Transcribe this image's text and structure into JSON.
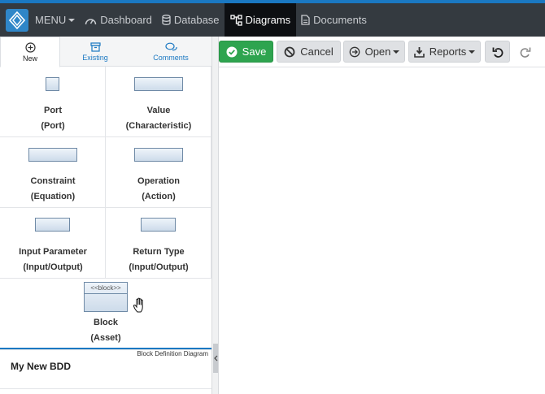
{
  "navbar": {
    "menu_label": "MENU",
    "items": [
      {
        "label": "Dashboard",
        "icon": "gauge-icon"
      },
      {
        "label": "Database",
        "icon": "database-icon"
      },
      {
        "label": "Diagrams",
        "icon": "diagram-icon",
        "active": true
      },
      {
        "label": "Documents",
        "icon": "document-icon"
      }
    ]
  },
  "left_panel": {
    "tabs": [
      {
        "label": "New",
        "icon": "plus-circle-icon",
        "active": true
      },
      {
        "label": "Existing",
        "icon": "archive-box-icon"
      },
      {
        "label": "Comments",
        "icon": "comments-icon"
      }
    ],
    "palette": [
      {
        "name": "Port",
        "type": "(Port)"
      },
      {
        "name": "Value",
        "type": "(Characteristic)"
      },
      {
        "name": "Constraint",
        "type": "(Equation)"
      },
      {
        "name": "Operation",
        "type": "(Action)"
      },
      {
        "name": "Input Parameter",
        "type": "(Input/Output)"
      },
      {
        "name": "Return Type",
        "type": "(Input/Output)"
      },
      {
        "name": "Block",
        "type": "(Asset)",
        "stereotype": "<<block>>"
      }
    ],
    "diagram": {
      "type_label": "Block Definition Diagram",
      "title": "My New BDD"
    }
  },
  "toolbar": {
    "save_label": "Save",
    "cancel_label": "Cancel",
    "open_label": "Open",
    "reports_label": "Reports"
  },
  "colors": {
    "accent": "#1a78c2",
    "navbar": "#343a40",
    "save": "#2ea44f"
  }
}
